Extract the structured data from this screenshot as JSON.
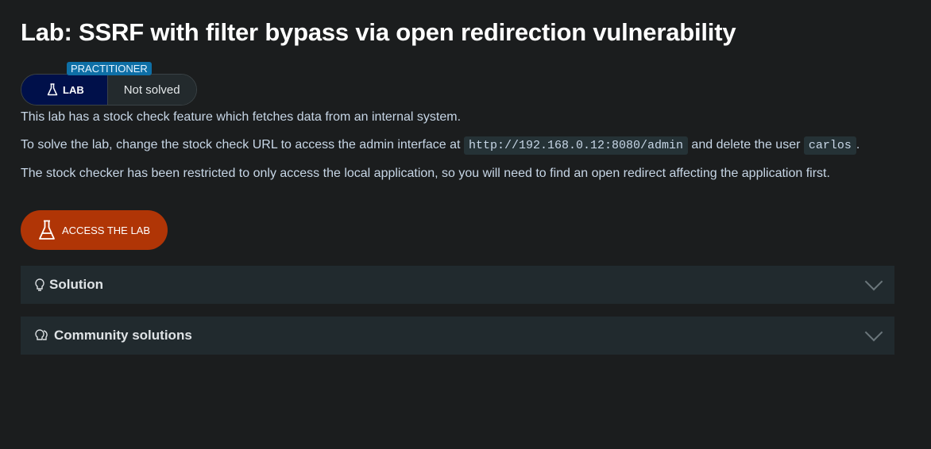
{
  "title": "Lab: SSRF with filter bypass via open redirection vulnerability",
  "badge": {
    "level": "PRACTITIONER",
    "type": "LAB",
    "status": "Not solved"
  },
  "description": {
    "p1": "This lab has a stock check feature which fetches data from an internal system.",
    "p2_a": "To solve the lab, change the stock check URL to access the admin interface at ",
    "p2_code1": "http://192.168.0.12:8080/admin",
    "p2_b": " and delete the user ",
    "p2_code2": "carlos",
    "p2_c": ".",
    "p3": "The stock checker has been restricted to only access the local application, so you will need to find an open redirect affecting the application first."
  },
  "access_button": "ACCESS THE LAB",
  "accordions": [
    {
      "label": "Solution",
      "icon": "lightbulb-icon"
    },
    {
      "label": "Community solutions",
      "icon": "lightbulbs-icon"
    }
  ]
}
